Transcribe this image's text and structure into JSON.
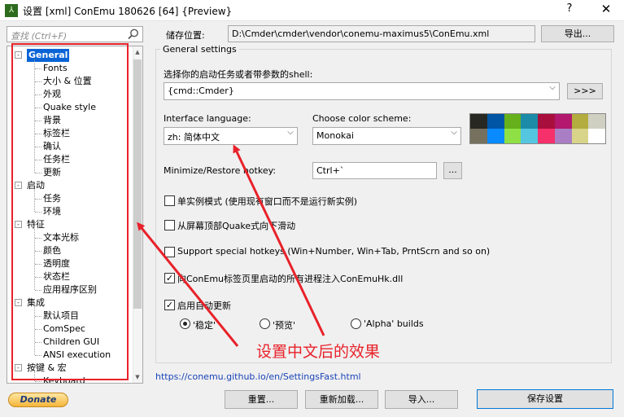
{
  "window": {
    "title": "设置 [xml] ConEmu 180626 [64] {Preview}",
    "help_label": "?",
    "close_label": "✕"
  },
  "search": {
    "placeholder": "查找 (Ctrl+F)"
  },
  "tree": {
    "items": [
      {
        "label": "General",
        "level": 0,
        "expander": "-",
        "selected": true
      },
      {
        "label": "Fonts",
        "level": 1
      },
      {
        "label": "大小 & 位置",
        "level": 1
      },
      {
        "label": "外观",
        "level": 1
      },
      {
        "label": "Quake style",
        "level": 1
      },
      {
        "label": "背景",
        "level": 1
      },
      {
        "label": "标签栏",
        "level": 1
      },
      {
        "label": "确认",
        "level": 1
      },
      {
        "label": "任务栏",
        "level": 1
      },
      {
        "label": "更新",
        "level": 1
      },
      {
        "label": "启动",
        "level": 0,
        "expander": "-"
      },
      {
        "label": "任务",
        "level": 1
      },
      {
        "label": "环境",
        "level": 1
      },
      {
        "label": "特征",
        "level": 0,
        "expander": "-"
      },
      {
        "label": "文本光标",
        "level": 1
      },
      {
        "label": "颜色",
        "level": 1
      },
      {
        "label": "透明度",
        "level": 1
      },
      {
        "label": "状态栏",
        "level": 1
      },
      {
        "label": "应用程序区别",
        "level": 1
      },
      {
        "label": "集成",
        "level": 0,
        "expander": "-"
      },
      {
        "label": "默认项目",
        "level": 1
      },
      {
        "label": "ComSpec",
        "level": 1
      },
      {
        "label": "Children GUI",
        "level": 1
      },
      {
        "label": "ANSI execution",
        "level": 1
      },
      {
        "label": "按键 & 宏",
        "level": 0,
        "expander": "-"
      },
      {
        "label": "Keyboard",
        "level": 1
      }
    ]
  },
  "storage": {
    "label": "储存位置:",
    "path": "D:\\Cmder\\cmder\\vendor\\conemu-maximus5\\ConEmu.xml",
    "export_label": "导出..."
  },
  "general": {
    "group_title": "General settings",
    "shell_label": "选择你的启动任务或者带参数的shell:",
    "shell_value": "{cmd::Cmder}",
    "shell_more": ">>>",
    "lang_label": "Interface language:",
    "lang_value": "zh: 简体中文",
    "scheme_label": "Choose color scheme:",
    "scheme_value": "Monokai",
    "hotkey_label": "Minimize/Restore hotkey:",
    "hotkey_value": "Ctrl+`",
    "hotkey_more": "...",
    "checkboxes": [
      {
        "label": "单实例模式 (使用现有窗口而不是运行新实例)",
        "checked": false
      },
      {
        "label": "从屏幕顶部Quake式向下滑动",
        "checked": false
      },
      {
        "label": "Support special hotkeys (Win+Number, Win+Tab, PrntScrn and so on)",
        "checked": false
      },
      {
        "label": "向ConEmu标签页里启动的所有进程注入ConEmuHk.dll",
        "checked": true
      },
      {
        "label": "启用自动更新",
        "checked": true
      }
    ],
    "radios": [
      {
        "label": "'稳定'",
        "checked": true
      },
      {
        "label": "'预览'",
        "checked": false
      },
      {
        "label": "'Alpha' builds",
        "checked": false
      }
    ]
  },
  "palette_colors": [
    "#272822",
    "#0055a4",
    "#66b01c",
    "#1c8ba8",
    "#a80f3d",
    "#b2186d",
    "#b3ad3f",
    "#cfcfc2",
    "#75715e",
    "#0a8aff",
    "#8ee045",
    "#55c6e0",
    "#f5306a",
    "#a97ec4",
    "#d8d48a",
    "#ffffff"
  ],
  "footer": {
    "link": "https://conemu.github.io/en/SettingsFast.html",
    "donate": "Donate",
    "reset": "重置...",
    "reload": "重新加载...",
    "import": "导入...",
    "save": "保存设置"
  },
  "annotation": {
    "text": "设置中文后的效果",
    "color": "#e8222a"
  }
}
